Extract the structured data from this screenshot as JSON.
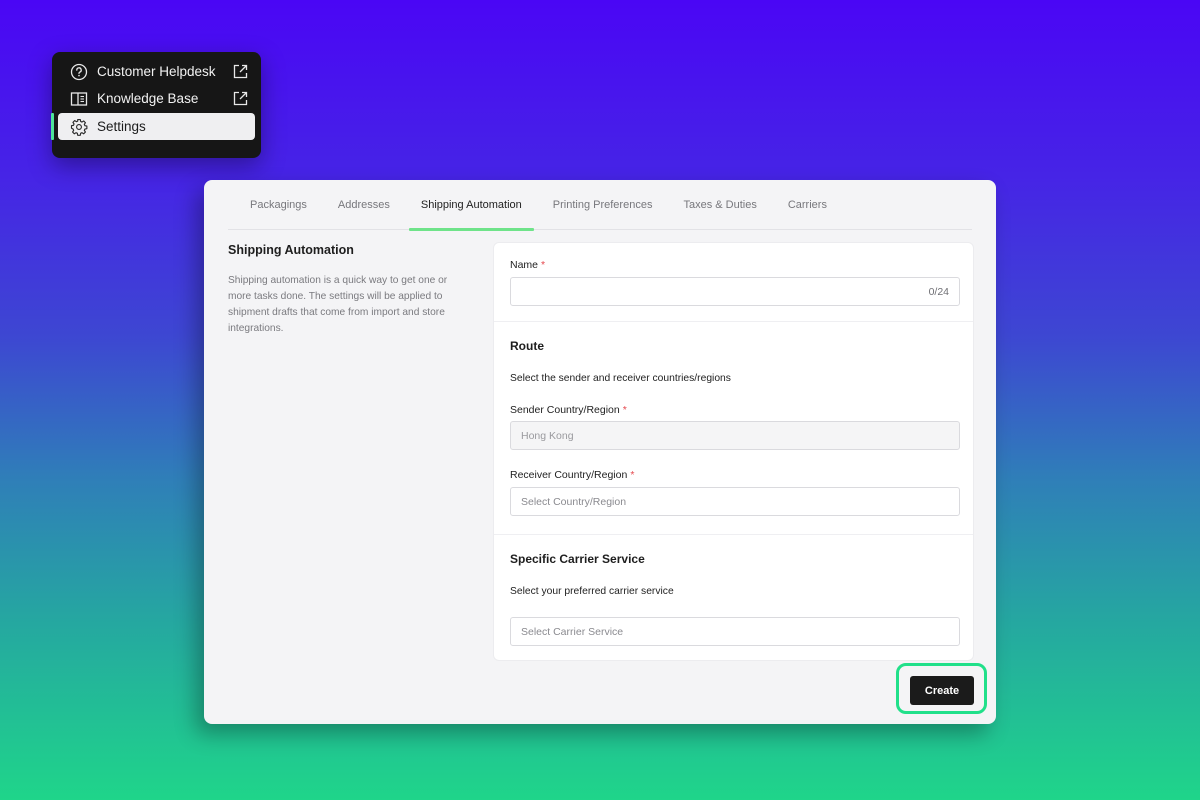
{
  "nav_menu": {
    "items": [
      {
        "label": "Customer Helpdesk",
        "icon": "help-circle-icon",
        "external": true,
        "active": false
      },
      {
        "label": "Knowledge Base",
        "icon": "book-open-icon",
        "external": true,
        "active": false
      },
      {
        "label": "Settings",
        "icon": "gear-icon",
        "external": false,
        "active": true
      }
    ],
    "accent_color": "#4ee39a"
  },
  "tabs": [
    {
      "label": "Packagings",
      "active": false
    },
    {
      "label": "Addresses",
      "active": false
    },
    {
      "label": "Shipping Automation",
      "active": true
    },
    {
      "label": "Printing Preferences",
      "active": false
    },
    {
      "label": "Taxes & Duties",
      "active": false
    },
    {
      "label": "Carriers",
      "active": false
    }
  ],
  "side": {
    "title": "Shipping Automation",
    "description": "Shipping automation is a quick way to get one or more tasks done. The settings will be applied to shipment drafts that come from import and store integrations."
  },
  "form": {
    "name": {
      "label": "Name",
      "required_mark": "*",
      "value": "",
      "counter": "0/24"
    },
    "route": {
      "title": "Route",
      "subtitle": "Select the sender and receiver countries/regions",
      "sender": {
        "label": "Sender Country/Region",
        "required_mark": "*",
        "value": "Hong Kong"
      },
      "receiver": {
        "label": "Receiver Country/Region",
        "required_mark": "*",
        "placeholder": "Select Country/Region"
      }
    },
    "carrier": {
      "title": "Specific Carrier Service",
      "subtitle": "Select your preferred carrier service",
      "placeholder": "Select Carrier Service"
    }
  },
  "actions": {
    "create_label": "Create",
    "highlight_color": "#21e08a"
  }
}
